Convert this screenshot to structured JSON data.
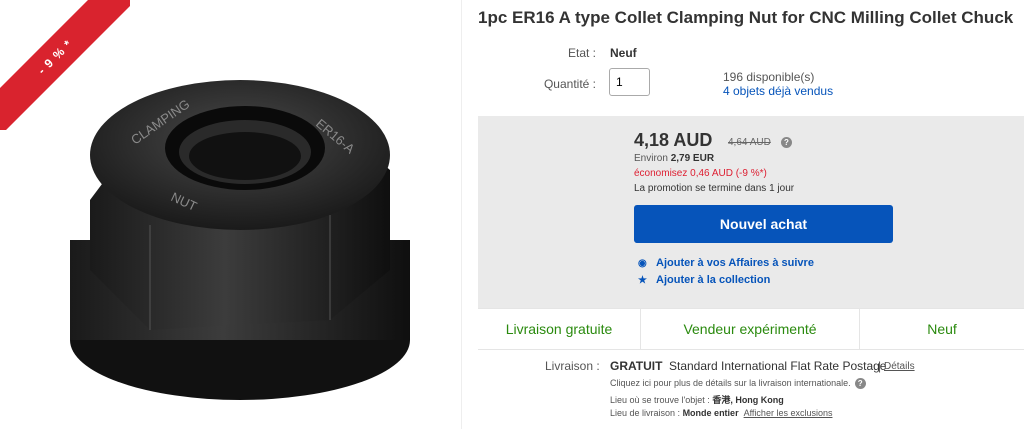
{
  "ribbon": {
    "discount": "- 9 % *"
  },
  "product": {
    "title": "1pc ER16 A type Collet Clamping Nut for CNC Milling Collet Chuck",
    "image_engraving": "CLAMPING NUT ER16-A"
  },
  "condition": {
    "label": "Etat :",
    "value": "Neuf"
  },
  "quantity": {
    "label": "Quantité :",
    "value": "1",
    "available": "196 disponible(s)",
    "sold": "4 objets déjà vendus"
  },
  "price": {
    "current": "4,18 AUD",
    "original": "4,64 AUD",
    "help_icon": "?",
    "approx_prefix": "Environ",
    "approx_value": "2,79 EUR",
    "savings": "économisez 0,46 AUD (-9 %*)",
    "promo": "La promotion se termine dans 1 jour",
    "buy_button": "Nouvel achat",
    "watch_link": "Ajouter à vos Affaires à suivre",
    "collection_link": "Ajouter à la collection",
    "watch_icon": "eye-icon",
    "collection_icon": "star-icon"
  },
  "badges": [
    "Livraison gratuite",
    "Vendeur expérimenté",
    "Neuf"
  ],
  "shipping": {
    "label": "Livraison :",
    "free": "GRATUIT",
    "service": "Standard International Flat Rate Postage",
    "separator": "|",
    "details_link": "Détails",
    "more_info": "Cliquez ici pour plus de détails sur la livraison internationale.",
    "location_label": "Lieu où se trouve l'objet :",
    "location_value": "香港, Hong Kong",
    "ship_to_label": "Lieu de livraison :",
    "ship_to_value": "Monde entier",
    "exclusions_link": "Afficher les exclusions"
  },
  "colors": {
    "buy": "#0654ba",
    "green": "#2a8a0e",
    "red": "#dd1e31",
    "ribbon": "#d9232e"
  }
}
